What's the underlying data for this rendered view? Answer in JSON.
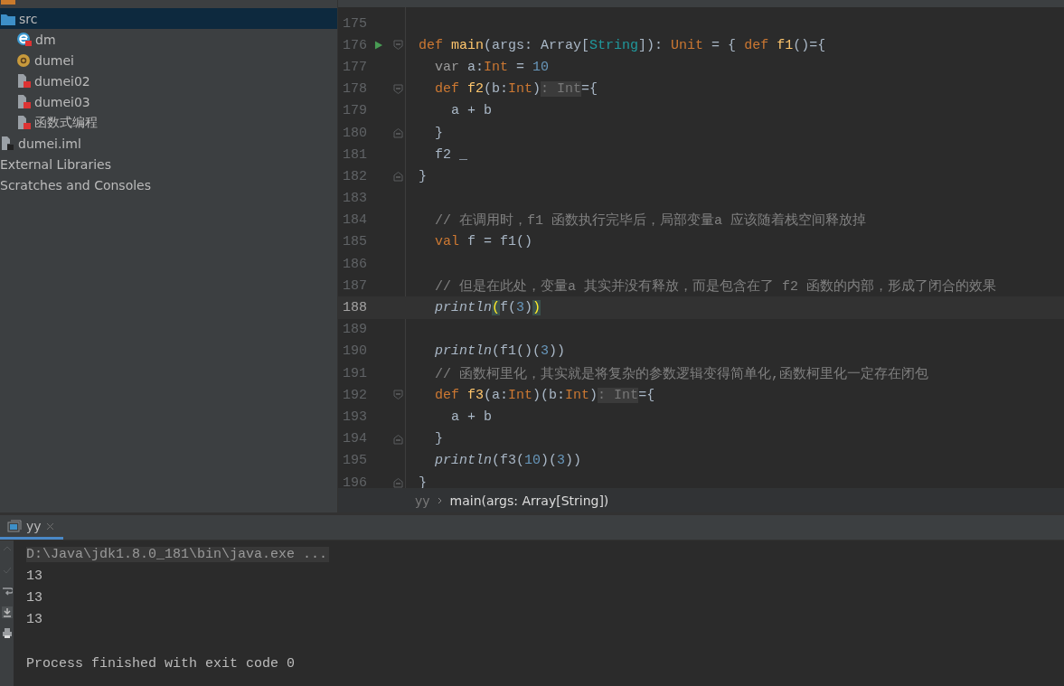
{
  "project_tree": [
    {
      "kind": "folder-orange",
      "selected": false
    },
    {
      "label": "src",
      "kind": "folder",
      "selected": true,
      "children": [
        {
          "label": "dm",
          "kind": "scala-object",
          "selected": false
        },
        {
          "label": "dumei",
          "kind": "package",
          "selected": false
        },
        {
          "label": "dumei02",
          "kind": "scala-file",
          "selected": false
        },
        {
          "label": "dumei03",
          "kind": "scala-file",
          "selected": false
        },
        {
          "label": "函数式编程",
          "kind": "scala-file",
          "selected": false
        }
      ]
    },
    {
      "label": "dumei.iml",
      "kind": "module-file",
      "selected": false
    },
    {
      "label": "External Libraries",
      "kind": "plain",
      "selected": false
    },
    {
      "label": "Scratches and Consoles",
      "kind": "plain",
      "selected": false
    }
  ],
  "editor": {
    "lines": [
      {
        "number": "175",
        "current": false,
        "run": false,
        "fold_start": false,
        "fold_end": false
      },
      {
        "number": "176",
        "current": false,
        "run": true,
        "fold_start": true,
        "fold_end": false,
        "tokens": [
          {
            "kind": "kw",
            "text": "def"
          },
          {
            "kind": "fn",
            "text": " main"
          },
          {
            "kind": "plain",
            "text": "(args: Array["
          },
          {
            "kind": "typeparam",
            "text": "String"
          },
          {
            "kind": "plain",
            "text": "]): "
          },
          {
            "kind": "kw",
            "text": "Unit"
          },
          {
            "kind": "plain",
            "text": " = { "
          },
          {
            "kind": "kw",
            "text": "def"
          },
          {
            "kind": "fn",
            "text": " f1"
          },
          {
            "kind": "plain",
            "text": "()={"
          }
        ]
      },
      {
        "number": "177",
        "current": false,
        "run": false,
        "fold_start": false,
        "fold_end": false,
        "tokens": [
          {
            "kind": "var",
            "text": "  var"
          },
          {
            "kind": "plain",
            "text": " a:"
          },
          {
            "kind": "kw",
            "text": "Int"
          },
          {
            "kind": "plain",
            "text": " = "
          },
          {
            "kind": "num",
            "text": "10"
          }
        ]
      },
      {
        "number": "178",
        "current": false,
        "run": false,
        "fold_start": true,
        "fold_end": false,
        "tokens": [
          {
            "kind": "kw",
            "text": "  def"
          },
          {
            "kind": "fn",
            "text": " f2"
          },
          {
            "kind": "plain",
            "text": "(b:"
          },
          {
            "kind": "kw",
            "text": "Int"
          },
          {
            "kind": "plain",
            "text": ")"
          },
          {
            "kind": "hint",
            "text": ": Int"
          },
          {
            "kind": "plain",
            "text": "={"
          }
        ]
      },
      {
        "number": "179",
        "current": false,
        "run": false,
        "fold_start": false,
        "fold_end": false,
        "tokens": [
          {
            "kind": "plain",
            "text": "    a + b"
          }
        ]
      },
      {
        "number": "180",
        "current": false,
        "run": false,
        "fold_start": false,
        "fold_end": true,
        "tokens": [
          {
            "kind": "plain",
            "text": "  }"
          }
        ]
      },
      {
        "number": "181",
        "current": false,
        "run": false,
        "fold_start": false,
        "fold_end": false,
        "tokens": [
          {
            "kind": "plain",
            "text": "  f2 _"
          }
        ]
      },
      {
        "number": "182",
        "current": false,
        "run": false,
        "fold_start": false,
        "fold_end": true,
        "tokens": [
          {
            "kind": "plain",
            "text": "}"
          }
        ]
      },
      {
        "number": "183",
        "current": false,
        "run": false,
        "fold_start": false,
        "fold_end": false
      },
      {
        "number": "184",
        "current": false,
        "run": false,
        "fold_start": false,
        "fold_end": false,
        "tokens": [
          {
            "kind": "comment",
            "text": "  // 在调用时，f1 函数执行完毕后，局部变量a 应该随着栈空间释放掉"
          }
        ]
      },
      {
        "number": "185",
        "current": false,
        "run": false,
        "fold_start": false,
        "fold_end": false,
        "tokens": [
          {
            "kind": "kw",
            "text": "  val"
          },
          {
            "kind": "plain",
            "text": " f = f1()"
          }
        ]
      },
      {
        "number": "186",
        "current": false,
        "run": false,
        "fold_start": false,
        "fold_end": false
      },
      {
        "number": "187",
        "current": false,
        "run": false,
        "fold_start": false,
        "fold_end": false,
        "tokens": [
          {
            "kind": "comment",
            "text": "  // 但是在此处，变量a 其实并没有释放，而是包含在了 f2 函数的内部，形成了闭合的效果"
          }
        ]
      },
      {
        "number": "188",
        "current": true,
        "run": false,
        "fold_start": false,
        "fold_end": false,
        "tokens": [
          {
            "kind": "call",
            "text": "  println"
          },
          {
            "kind": "match",
            "text": "("
          },
          {
            "kind": "plain",
            "text": "f("
          },
          {
            "kind": "num",
            "text": "3"
          },
          {
            "kind": "plain",
            "text": ")"
          },
          {
            "kind": "match",
            "text": ")"
          }
        ]
      },
      {
        "number": "189",
        "current": false,
        "run": false,
        "fold_start": false,
        "fold_end": false
      },
      {
        "number": "190",
        "current": false,
        "run": false,
        "fold_start": false,
        "fold_end": false,
        "tokens": [
          {
            "kind": "call",
            "text": "  println"
          },
          {
            "kind": "plain",
            "text": "(f1()("
          },
          {
            "kind": "num",
            "text": "3"
          },
          {
            "kind": "plain",
            "text": "))"
          }
        ]
      },
      {
        "number": "191",
        "current": false,
        "run": false,
        "fold_start": false,
        "fold_end": false,
        "tokens": [
          {
            "kind": "comment",
            "text": "  // 函数柯里化，其实就是将复杂的参数逻辑变得简单化,函数柯里化一定存在闭包"
          }
        ]
      },
      {
        "number": "192",
        "current": false,
        "run": false,
        "fold_start": true,
        "fold_end": false,
        "tokens": [
          {
            "kind": "kw",
            "text": "  def"
          },
          {
            "kind": "fn",
            "text": " f3"
          },
          {
            "kind": "plain",
            "text": "(a:"
          },
          {
            "kind": "kw",
            "text": "Int"
          },
          {
            "kind": "plain",
            "text": ")(b:"
          },
          {
            "kind": "kw",
            "text": "Int"
          },
          {
            "kind": "plain",
            "text": ")"
          },
          {
            "kind": "hint",
            "text": ": Int"
          },
          {
            "kind": "plain",
            "text": "={"
          }
        ]
      },
      {
        "number": "193",
        "current": false,
        "run": false,
        "fold_start": false,
        "fold_end": false,
        "tokens": [
          {
            "kind": "plain",
            "text": "    a + b"
          }
        ]
      },
      {
        "number": "194",
        "current": false,
        "run": false,
        "fold_start": false,
        "fold_end": true,
        "tokens": [
          {
            "kind": "plain",
            "text": "  }"
          }
        ]
      },
      {
        "number": "195",
        "current": false,
        "run": false,
        "fold_start": false,
        "fold_end": false,
        "tokens": [
          {
            "kind": "call",
            "text": "  println"
          },
          {
            "kind": "plain",
            "text": "(f3("
          },
          {
            "kind": "num",
            "text": "10"
          },
          {
            "kind": "plain",
            "text": ")("
          },
          {
            "kind": "num",
            "text": "3"
          },
          {
            "kind": "plain",
            "text": "))"
          }
        ]
      },
      {
        "number": "196",
        "current": false,
        "run": false,
        "fold_start": false,
        "fold_end": true,
        "tokens": [
          {
            "kind": "plain",
            "text": "}"
          }
        ]
      }
    ],
    "breadcrumbs": [
      {
        "label": "yy",
        "current": false
      },
      {
        "label": "main(args: Array[String])",
        "current": true
      }
    ]
  },
  "run_panel": {
    "tabs": [
      {
        "label": "yy",
        "selected": true
      }
    ],
    "console": [
      {
        "kind": "command",
        "text": "D:\\Java\\jdk1.8.0_181\\bin\\java.exe ..."
      },
      {
        "kind": "output",
        "text": "13"
      },
      {
        "kind": "output",
        "text": "13"
      },
      {
        "kind": "output",
        "text": "13"
      },
      {
        "kind": "exit",
        "text": "Process finished with exit code 0"
      }
    ]
  }
}
